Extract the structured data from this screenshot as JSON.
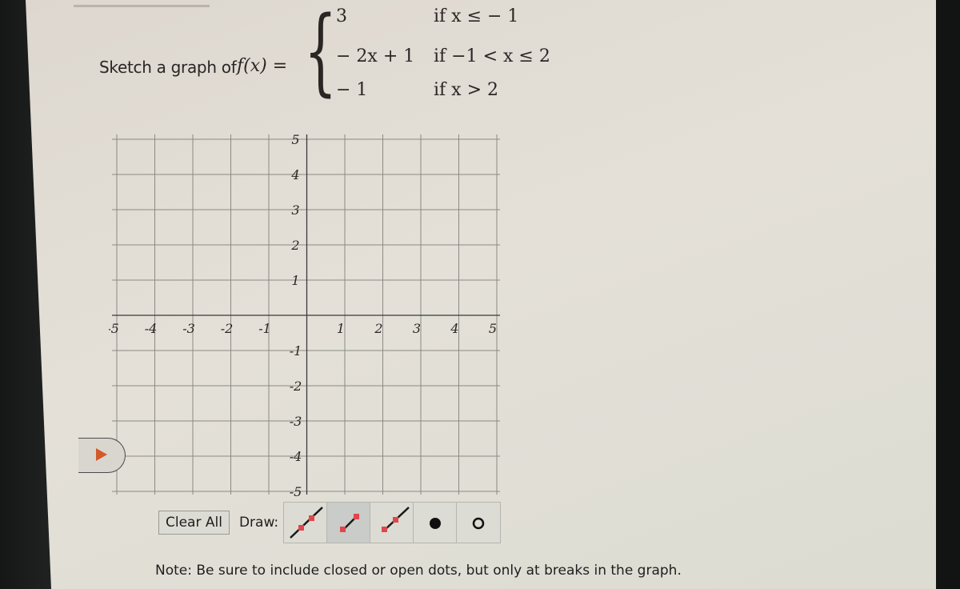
{
  "question": {
    "prompt": "Sketch a graph of",
    "function_label": "f(x) =",
    "cases": [
      {
        "expr": "3",
        "condition": "if  x ≤ − 1"
      },
      {
        "expr": "− 2x + 1",
        "condition": "if  −1 < x ≤ 2"
      },
      {
        "expr": "− 1",
        "condition": "if  x > 2"
      }
    ]
  },
  "chart_data": {
    "type": "scatter",
    "title": "",
    "xlabel": "",
    "ylabel": "",
    "xlim": [
      -5,
      5
    ],
    "ylim": [
      -5,
      5
    ],
    "grid": true,
    "x_ticks": [
      "-5",
      "-4",
      "-3",
      "-2",
      "-1",
      "1",
      "2",
      "3",
      "4",
      "5"
    ],
    "y_ticks": [
      "5",
      "4",
      "3",
      "2",
      "1",
      "-1",
      "-2",
      "-3",
      "-4",
      "-5"
    ],
    "series": []
  },
  "side_tab": {
    "icon": "play-triangle-icon",
    "color": "#d2592a"
  },
  "toolbar": {
    "clear_label": "Clear All",
    "draw_label": "Draw:",
    "tools": [
      {
        "name": "line",
        "icon": "line-tool-icon",
        "active": false
      },
      {
        "name": "segment",
        "icon": "segment-tool-icon",
        "active": true
      },
      {
        "name": "ray",
        "icon": "ray-tool-icon",
        "active": false
      },
      {
        "name": "closed-dot",
        "icon": "closed-dot-icon",
        "active": false
      },
      {
        "name": "open-dot",
        "icon": "open-dot-icon",
        "active": false
      }
    ]
  },
  "note": "Note: Be sure to include closed or open dots, but only at breaks in the graph.",
  "colors": {
    "handle": "#e0474c",
    "tool_line": "#1a1a1a",
    "active_tool_bg": "#c9ccc8"
  }
}
